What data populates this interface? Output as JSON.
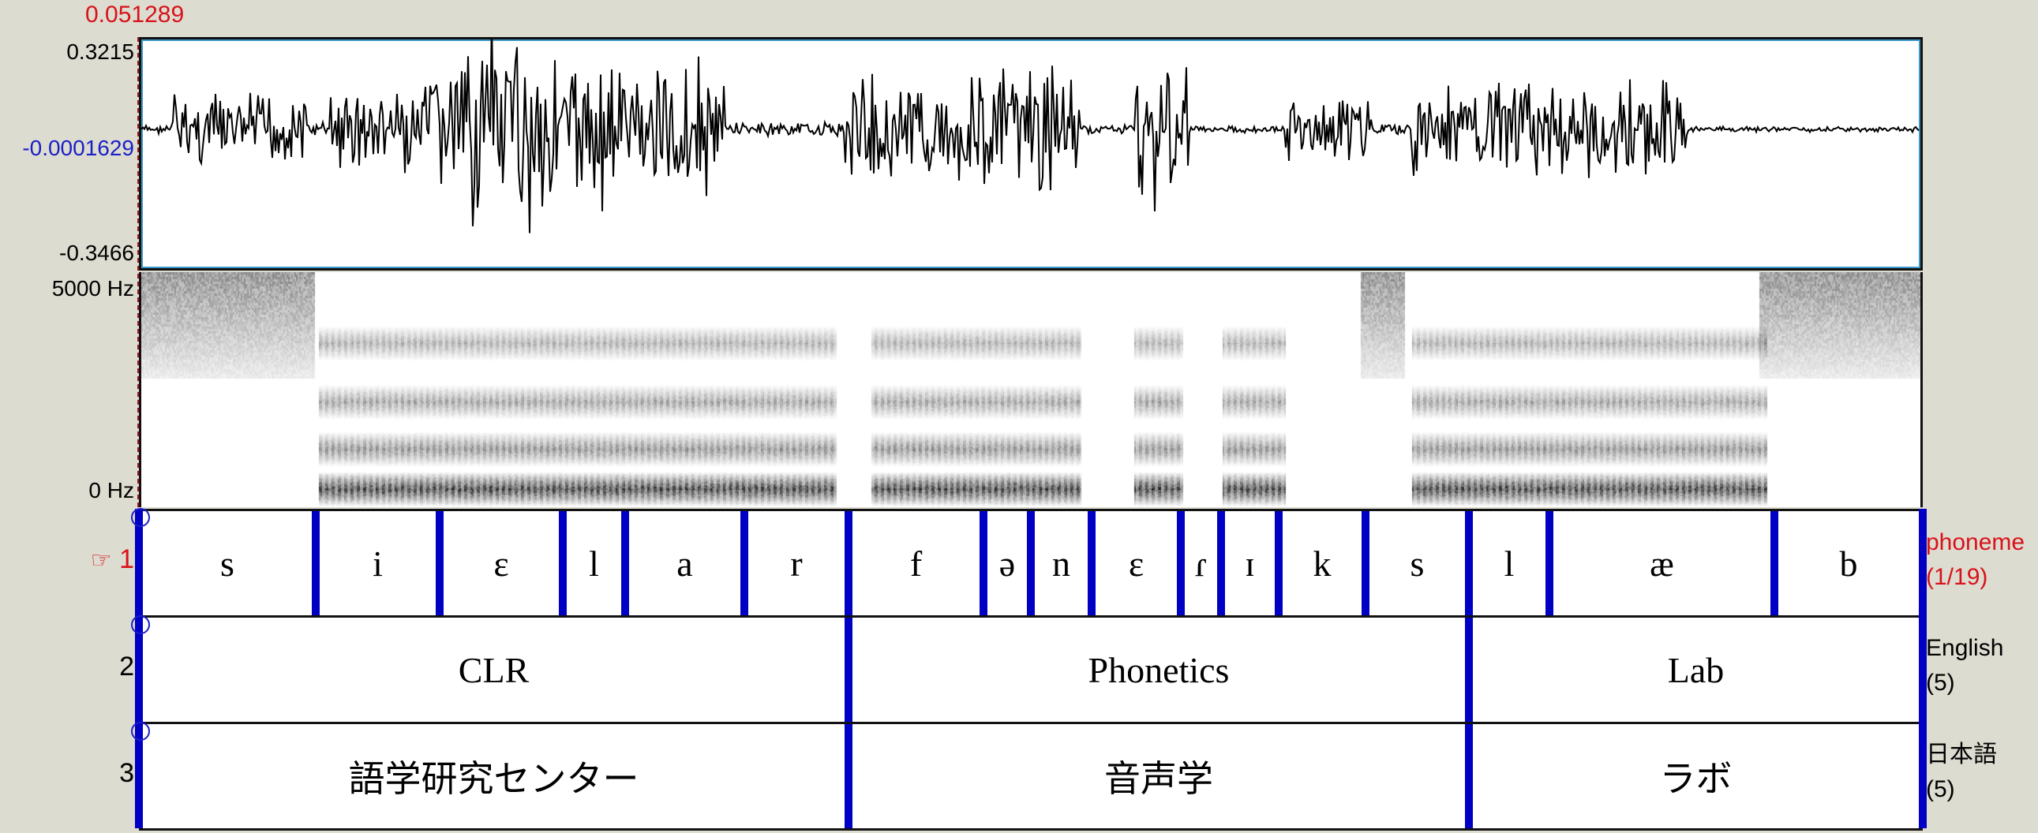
{
  "cursor": {
    "time_label": "0.051289"
  },
  "waveform": {
    "y_max_label": "0.3215",
    "y_cursor_label": "-0.0001629",
    "y_min_label": "-0.3466"
  },
  "spectrogram": {
    "freq_top_label": "5000 Hz",
    "freq_bottom_label": "0 Hz"
  },
  "tiers": [
    {
      "number": "1",
      "selected": true,
      "pointer_icon": "☞",
      "name": "phoneme",
      "count": "(1/19)",
      "intervals": [
        {
          "label": "s"
        },
        {
          "label": "i"
        },
        {
          "label": "ɛ"
        },
        {
          "label": "l"
        },
        {
          "label": "a"
        },
        {
          "label": "r"
        },
        {
          "label": "f"
        },
        {
          "label": "ə"
        },
        {
          "label": "n"
        },
        {
          "label": "ɛ"
        },
        {
          "label": "ɾ"
        },
        {
          "label": "ɪ"
        },
        {
          "label": "k"
        },
        {
          "label": "s"
        },
        {
          "label": "l"
        },
        {
          "label": "æ"
        },
        {
          "label": "b"
        }
      ]
    },
    {
      "number": "2",
      "selected": false,
      "name": "English",
      "count": "(5)",
      "intervals": [
        {
          "label": "CLR"
        },
        {
          "label": "Phonetics"
        },
        {
          "label": "Lab"
        }
      ]
    },
    {
      "number": "3",
      "selected": false,
      "name": "日本語",
      "count": "(5)",
      "intervals": [
        {
          "label": "語学研究センター"
        },
        {
          "label": "音声学"
        },
        {
          "label": "ラボ"
        }
      ]
    }
  ],
  "colors": {
    "background": "#dddcd0",
    "boundary": "#0000c4",
    "selected_tier": "#d9121b",
    "cursor_value": "#1a1fc6"
  }
}
